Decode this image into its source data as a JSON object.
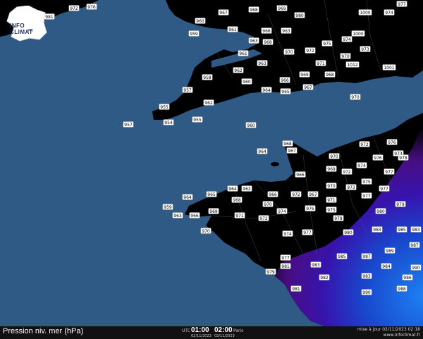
{
  "map_title": "Pression niv. mer (hPa)",
  "logo": {
    "text": "INFO CLIMAT",
    "sub": "FR"
  },
  "time": {
    "utc_label": "UTC",
    "utc_time": "01:00",
    "utc_date": "02/11/2023",
    "local_time": "02:00",
    "local_label": "Paris",
    "local_date": "02/11/2023"
  },
  "update_text": "mise à jour 02/11/2023 02:18",
  "site": "www.infoclimat.fr",
  "colors": {
    "sea": "#2e5a85",
    "land": "#000000",
    "low_pressure": "#4b0f8a",
    "lowest_pressure": "#1e7bff"
  },
  "stations": [
    {
      "v": "975"
    },
    {
      "v": "970"
    },
    {
      "v": "972"
    },
    {
      "v": "976"
    },
    {
      "v": "1000"
    },
    {
      "v": "974"
    },
    {
      "v": "960"
    },
    {
      "v": "959"
    },
    {
      "v": "967"
    },
    {
      "v": "968"
    },
    {
      "v": "969"
    },
    {
      "v": "980"
    },
    {
      "v": "961"
    },
    {
      "v": "966"
    },
    {
      "v": "963"
    },
    {
      "v": "1000"
    },
    {
      "v": "977"
    },
    {
      "v": "963"
    },
    {
      "v": "961"
    },
    {
      "v": "968"
    },
    {
      "v": "970"
    },
    {
      "v": "972"
    },
    {
      "v": "975"
    },
    {
      "v": "974"
    },
    {
      "v": "962"
    },
    {
      "v": "963"
    },
    {
      "v": "966"
    },
    {
      "v": "969"
    },
    {
      "v": "971"
    },
    {
      "v": "1012"
    },
    {
      "v": "1001"
    },
    {
      "v": "957"
    },
    {
      "v": "962"
    },
    {
      "v": "964"
    },
    {
      "v": "967"
    },
    {
      "v": "968"
    },
    {
      "v": "970"
    },
    {
      "v": "973"
    },
    {
      "v": "955"
    },
    {
      "v": "958"
    },
    {
      "v": "960"
    },
    {
      "v": "965"
    },
    {
      "v": "970"
    },
    {
      "v": "957"
    },
    {
      "v": "954"
    },
    {
      "v": "955"
    },
    {
      "v": "960"
    },
    {
      "v": "964"
    },
    {
      "v": "968"
    },
    {
      "v": "967"
    },
    {
      "v": "970"
    },
    {
      "v": "972"
    },
    {
      "v": "976"
    },
    {
      "v": "973"
    },
    {
      "v": "966"
    },
    {
      "v": "969"
    },
    {
      "v": "972"
    },
    {
      "v": "974"
    },
    {
      "v": "976"
    },
    {
      "v": "977"
    },
    {
      "v": "978"
    },
    {
      "v": "962"
    },
    {
      "v": "964"
    },
    {
      "v": "966"
    },
    {
      "v": "967"
    },
    {
      "v": "970"
    },
    {
      "v": "971"
    },
    {
      "v": "973"
    },
    {
      "v": "975"
    },
    {
      "v": "977"
    },
    {
      "v": "959"
    },
    {
      "v": "964"
    },
    {
      "v": "965"
    },
    {
      "v": "968"
    },
    {
      "v": "970"
    },
    {
      "v": "972"
    },
    {
      "v": "975"
    },
    {
      "v": "977"
    },
    {
      "v": "979"
    },
    {
      "v": "963"
    },
    {
      "v": "966"
    },
    {
      "v": "969"
    },
    {
      "v": "971"
    },
    {
      "v": "974"
    },
    {
      "v": "976"
    },
    {
      "v": "978"
    },
    {
      "v": "980"
    },
    {
      "v": "983"
    },
    {
      "v": "970"
    },
    {
      "v": "972"
    },
    {
      "v": "974"
    },
    {
      "v": "977"
    },
    {
      "v": "980"
    },
    {
      "v": "983"
    },
    {
      "v": "985"
    },
    {
      "v": "987"
    },
    {
      "v": "979"
    },
    {
      "v": "981"
    },
    {
      "v": "983"
    },
    {
      "v": "985"
    },
    {
      "v": "987"
    },
    {
      "v": "989"
    },
    {
      "v": "990"
    },
    {
      "v": "981"
    },
    {
      "v": "977"
    },
    {
      "v": "982"
    },
    {
      "v": "983"
    },
    {
      "v": "984"
    },
    {
      "v": "986"
    },
    {
      "v": "988"
    },
    {
      "v": "990"
    },
    {
      "v": "981"
    },
    {
      "v": "975"
    }
  ]
}
